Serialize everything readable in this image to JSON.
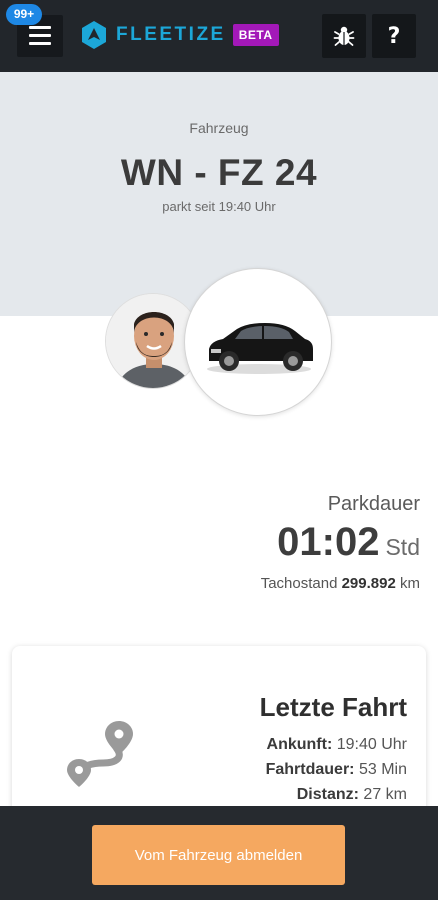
{
  "header": {
    "notification_count": "99+",
    "logo_text": "FLEETIZE",
    "beta_label": "BETA",
    "help_label": "?",
    "icons": [
      "menu-icon",
      "logo-icon",
      "bug-icon",
      "help-icon"
    ],
    "colors": {
      "background": "#22262b",
      "brand": "#1ca7d8",
      "beta": "#a318b8",
      "badge": "#1e88e5"
    }
  },
  "vehicle": {
    "label": "Fahrzeug",
    "plate": "WN - FZ 24",
    "status": "parkt seit 19:40 Uhr"
  },
  "parking": {
    "label": "Parkdauer",
    "duration": "01:02",
    "unit": "Std",
    "tacho_label": "Tachostand",
    "tacho_value": "299.892",
    "tacho_unit": "km"
  },
  "last_trip": {
    "title": "Letzte Fahrt",
    "arrival_label": "Ankunft:",
    "arrival_value": "19:40 Uhr",
    "duration_label": "Fahrtdauer:",
    "duration_value": "53 Min",
    "distance_label": "Distanz:",
    "distance_value": "27 km",
    "icon": "route-icon"
  },
  "footer": {
    "logout_label": "Vom Fahrzeug abmelden",
    "colors": {
      "button": "#f5a860",
      "bar": "#262a2f"
    }
  }
}
